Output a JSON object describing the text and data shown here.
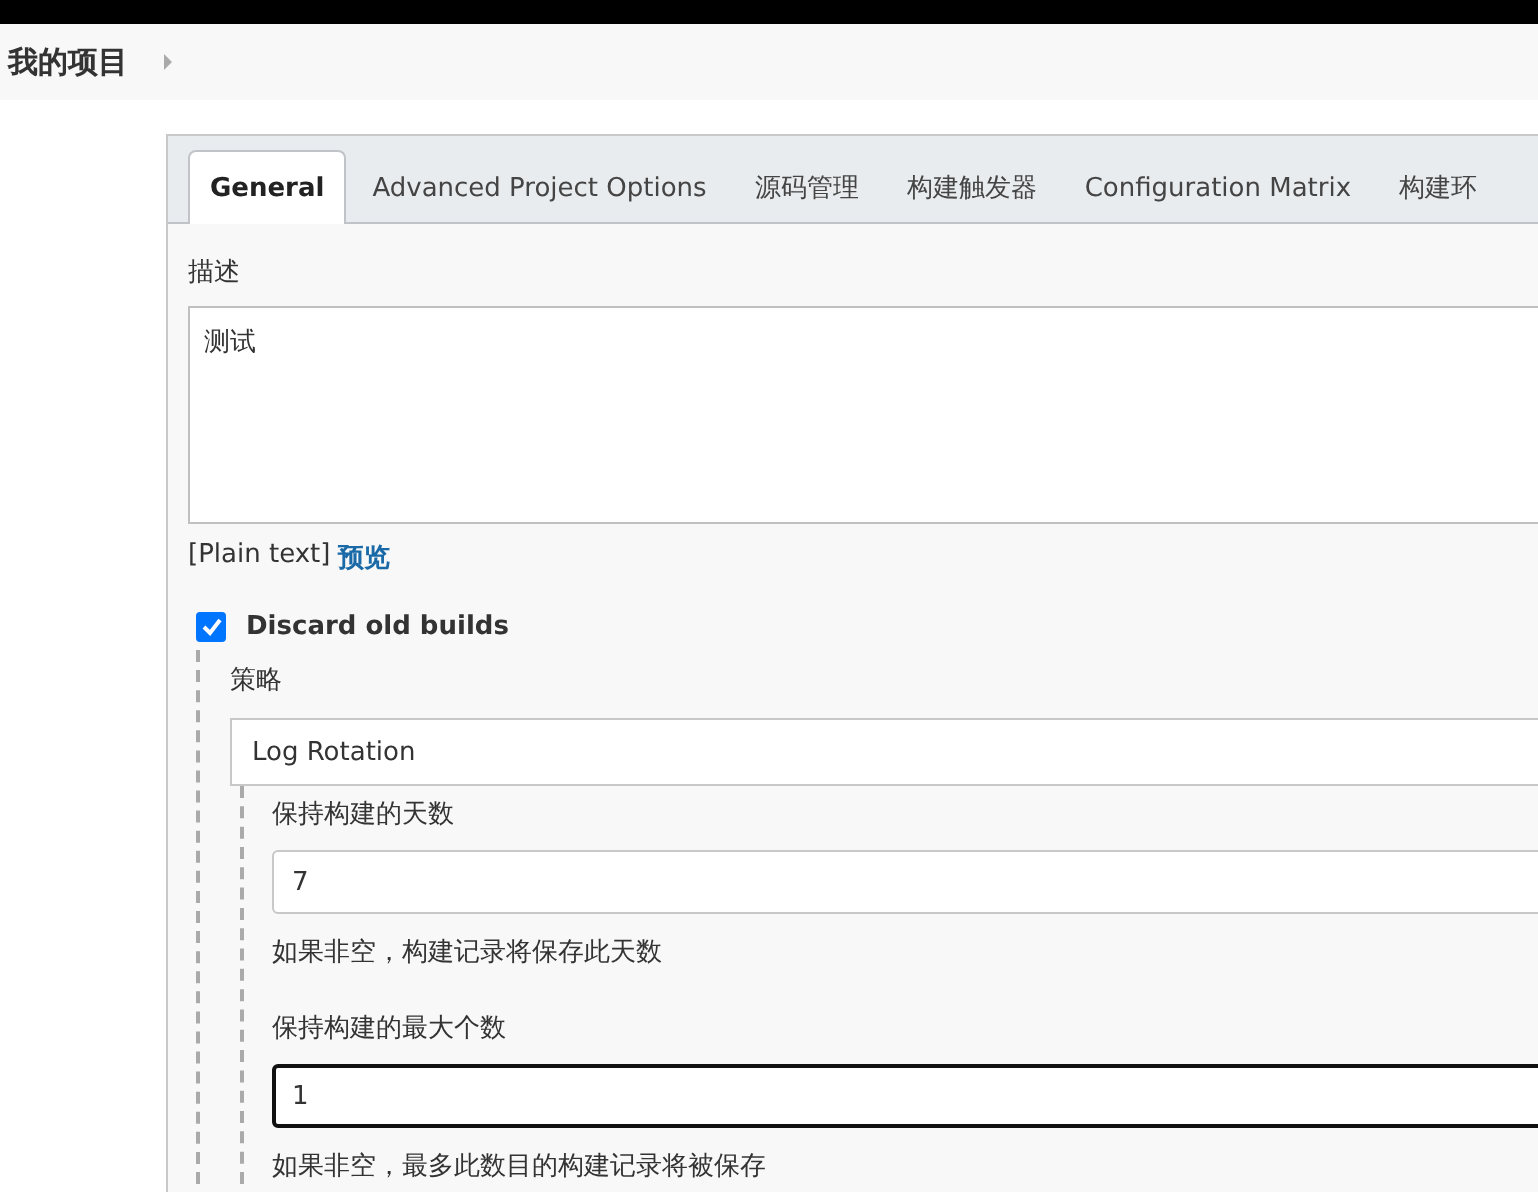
{
  "breadcrumb": {
    "title": "我的项目"
  },
  "tabs": [
    {
      "label": "General",
      "selected": true
    },
    {
      "label": "Advanced Project Options",
      "selected": false
    },
    {
      "label": "源码管理",
      "selected": false
    },
    {
      "label": "构建触发器",
      "selected": false
    },
    {
      "label": "Configuration Matrix",
      "selected": false
    },
    {
      "label": "构建环",
      "selected": false
    }
  ],
  "description": {
    "label": "描述",
    "value": "测试",
    "format": "[Plain text]",
    "preview_link": "预览"
  },
  "discard_old_builds": {
    "label": "Discard old builds",
    "checked": true
  },
  "strategy": {
    "label": "策略",
    "value": "Log Rotation"
  },
  "fields": [
    {
      "label": "保持构建的天数",
      "value": "7",
      "help": "如果非空，构建记录将保存此天数",
      "focused": false
    },
    {
      "label": "保持构建的最大个数",
      "value": "1",
      "help": "如果非空，最多此数目的构建记录将被保存",
      "focused": true
    }
  ]
}
